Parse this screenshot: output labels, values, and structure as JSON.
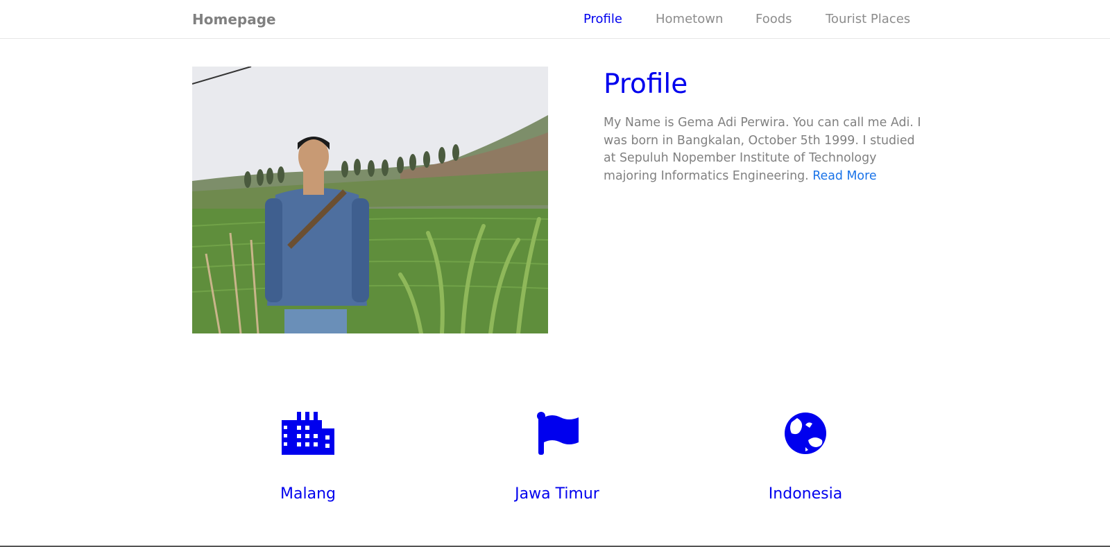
{
  "navbar": {
    "brand": "Homepage",
    "links": [
      {
        "label": "Profile",
        "active": true
      },
      {
        "label": "Hometown",
        "active": false
      },
      {
        "label": "Foods",
        "active": false
      },
      {
        "label": "Tourist Places",
        "active": false
      }
    ]
  },
  "profile": {
    "title": "Profile",
    "description": "My Name is Gema Adi Perwira. You can call me Adi. I was born in Bangkalan, October 5th 1999. I studied at Sepuluh Nopember Institute of Technology majoring Informatics Engineering.",
    "read_more": "Read More"
  },
  "features": [
    {
      "label": "Malang",
      "icon": "city-icon"
    },
    {
      "label": "Jawa Timur",
      "icon": "flag-icon"
    },
    {
      "label": "Indonesia",
      "icon": "globe-icon"
    }
  ],
  "colors": {
    "accent": "#0000ee",
    "link": "#1a73e8",
    "muted_text": "#808080"
  }
}
